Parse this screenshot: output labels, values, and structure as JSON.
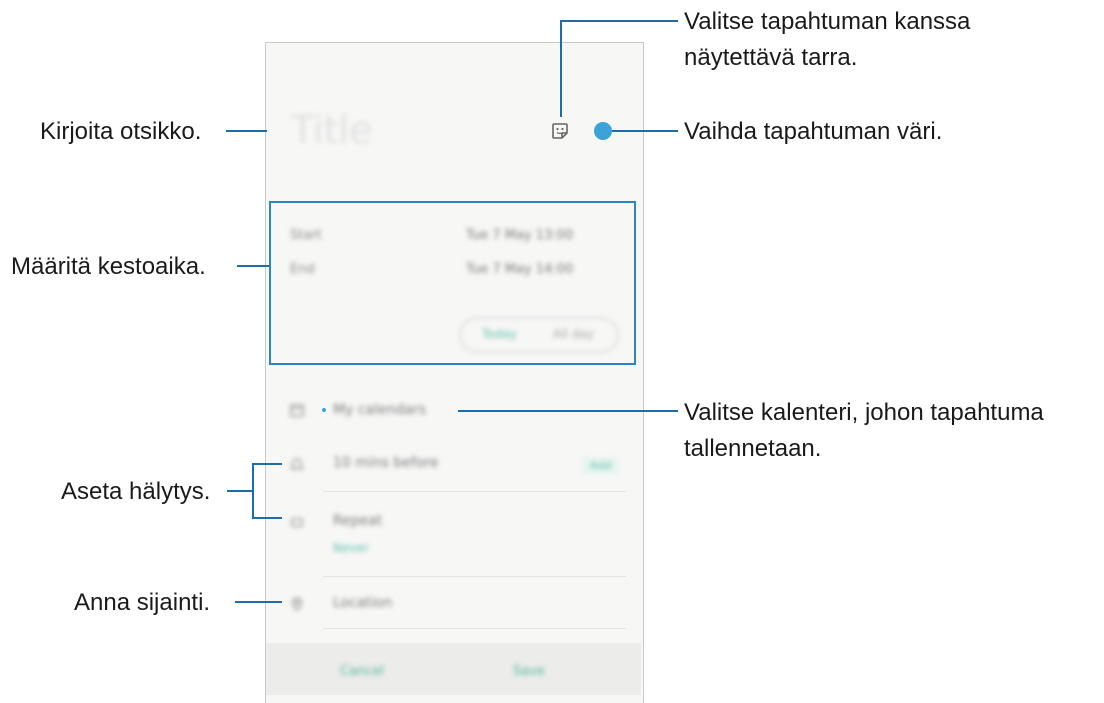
{
  "annotations": {
    "sticker_line1": "Valitse tapahtuman kanssa",
    "sticker_line2": "näytettävä tarra.",
    "title": "Kirjoita otsikko.",
    "color": "Vaihda tapahtuman väri.",
    "duration": "Määritä kestoaika.",
    "calendar_line1": "Valitse kalenteri, johon tapahtuma",
    "calendar_line2": "tallennetaan.",
    "alarm": "Aseta hälytys.",
    "location": "Anna sijainti."
  },
  "event": {
    "title_placeholder": "Title",
    "start_label": "Start",
    "start_value": "Tue 7 May  13:00",
    "end_label": "End",
    "end_value": "Tue 7 May  14:00",
    "toggle_left": "Today",
    "toggle_right": "All day",
    "calendar": "My calendars",
    "reminder": "10 mins before",
    "reminder_badge": "Add",
    "repeat": "Repeat",
    "repeat_value": "Never",
    "location_placeholder": "Location",
    "cancel": "Cancel",
    "save": "Save"
  },
  "colors": {
    "accent": "#2b86c4",
    "event_color": "#3ba3d8",
    "teal": "#5fc0a8"
  },
  "icons": [
    "sticker-icon",
    "color-dot",
    "calendar-icon",
    "bell-icon",
    "repeat-icon",
    "location-pin-icon"
  ]
}
